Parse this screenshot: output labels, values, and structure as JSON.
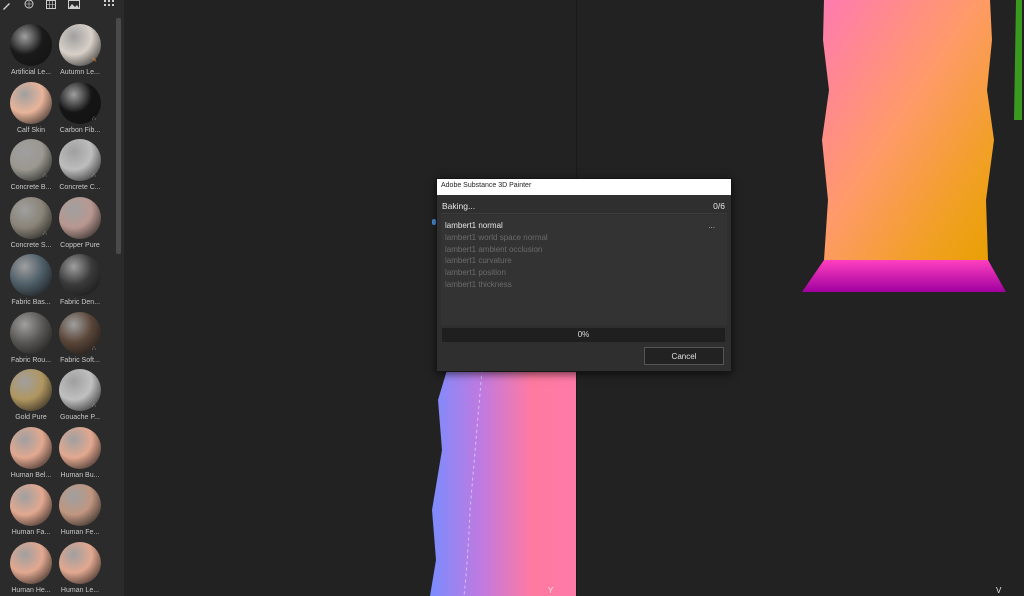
{
  "shelf": {
    "toolbar_icons": [
      "brush-icon",
      "sphere-icon",
      "grid-icon",
      "image-icon",
      "apps-grid-icon"
    ],
    "materials": [
      {
        "label": "Artificial Le...",
        "color": "#1a1a1a",
        "badge": ""
      },
      {
        "label": "Autumn Le...",
        "color": "#d8d0c8",
        "badge": "brush"
      },
      {
        "label": "Calf Skin",
        "color": "#e8b49a",
        "badge": ""
      },
      {
        "label": "Carbon Fib...",
        "color": "#151515",
        "badge": "sub"
      },
      {
        "label": "Concrete B...",
        "color": "#9a9890",
        "badge": "sub"
      },
      {
        "label": "Concrete C...",
        "color": "#bdbdbd",
        "badge": "sub"
      },
      {
        "label": "Concrete S...",
        "color": "#8a8478",
        "badge": "sub"
      },
      {
        "label": "Copper Pure",
        "color": "#b89890",
        "badge": ""
      },
      {
        "label": "Fabric Bas...",
        "color": "#4e5e68",
        "badge": ""
      },
      {
        "label": "Fabric Den...",
        "color": "#3a3a3a",
        "badge": ""
      },
      {
        "label": "Fabric Rou...",
        "color": "#5a5855",
        "badge": ""
      },
      {
        "label": "Fabric Soft...",
        "color": "#5a4538",
        "badge": "sub"
      },
      {
        "label": "Gold Pure",
        "color": "#b09660",
        "badge": ""
      },
      {
        "label": "Gouache P...",
        "color": "#c0c0c0",
        "badge": "sub"
      },
      {
        "label": "Human Bel...",
        "color": "#e2a890",
        "badge": ""
      },
      {
        "label": "Human Bu...",
        "color": "#e2a890",
        "badge": ""
      },
      {
        "label": "Human Fa...",
        "color": "#e2a890",
        "badge": ""
      },
      {
        "label": "Human Fe...",
        "color": "#c09680",
        "badge": ""
      },
      {
        "label": "Human He...",
        "color": "#e2a890",
        "badge": ""
      },
      {
        "label": "Human Le...",
        "color": "#e2a890",
        "badge": ""
      }
    ]
  },
  "viewport": {
    "axis_label_left": "Y",
    "axis_label_right": "V"
  },
  "dialog": {
    "title": "Adobe Substance 3D Painter",
    "status": "Baking...",
    "count": "0/6",
    "more": "...",
    "tasks": [
      {
        "label": "lambert1 normal",
        "state": "active"
      },
      {
        "label": "lambert1 world space normal",
        "state": "pending"
      },
      {
        "label": "lambert1 ambient occlusion",
        "state": "pending"
      },
      {
        "label": "lambert1 curvature",
        "state": "pending"
      },
      {
        "label": "lambert1 position",
        "state": "pending"
      },
      {
        "label": "lambert1 thickness",
        "state": "pending"
      }
    ],
    "progress_text": "0%",
    "progress_value": 0,
    "cancel_label": "Cancel",
    "accent": "#4a8fd8"
  }
}
